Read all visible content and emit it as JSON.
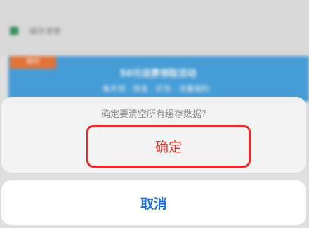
{
  "background": {
    "title": "缓存清理",
    "banner_tag": "限时",
    "banner_line1": "50元话费领取活动",
    "banner_line2": "每天领 · 现金 · 红包 · 流量福利"
  },
  "dialog": {
    "message": "确定要清空所有缓存数据?",
    "confirm_label": "确定",
    "cancel_label": "取消"
  },
  "colors": {
    "confirm": "#e5332c",
    "cancel": "#1f6fd9",
    "highlight_border": "#e52b2b",
    "banner": "#4aa6e4"
  }
}
